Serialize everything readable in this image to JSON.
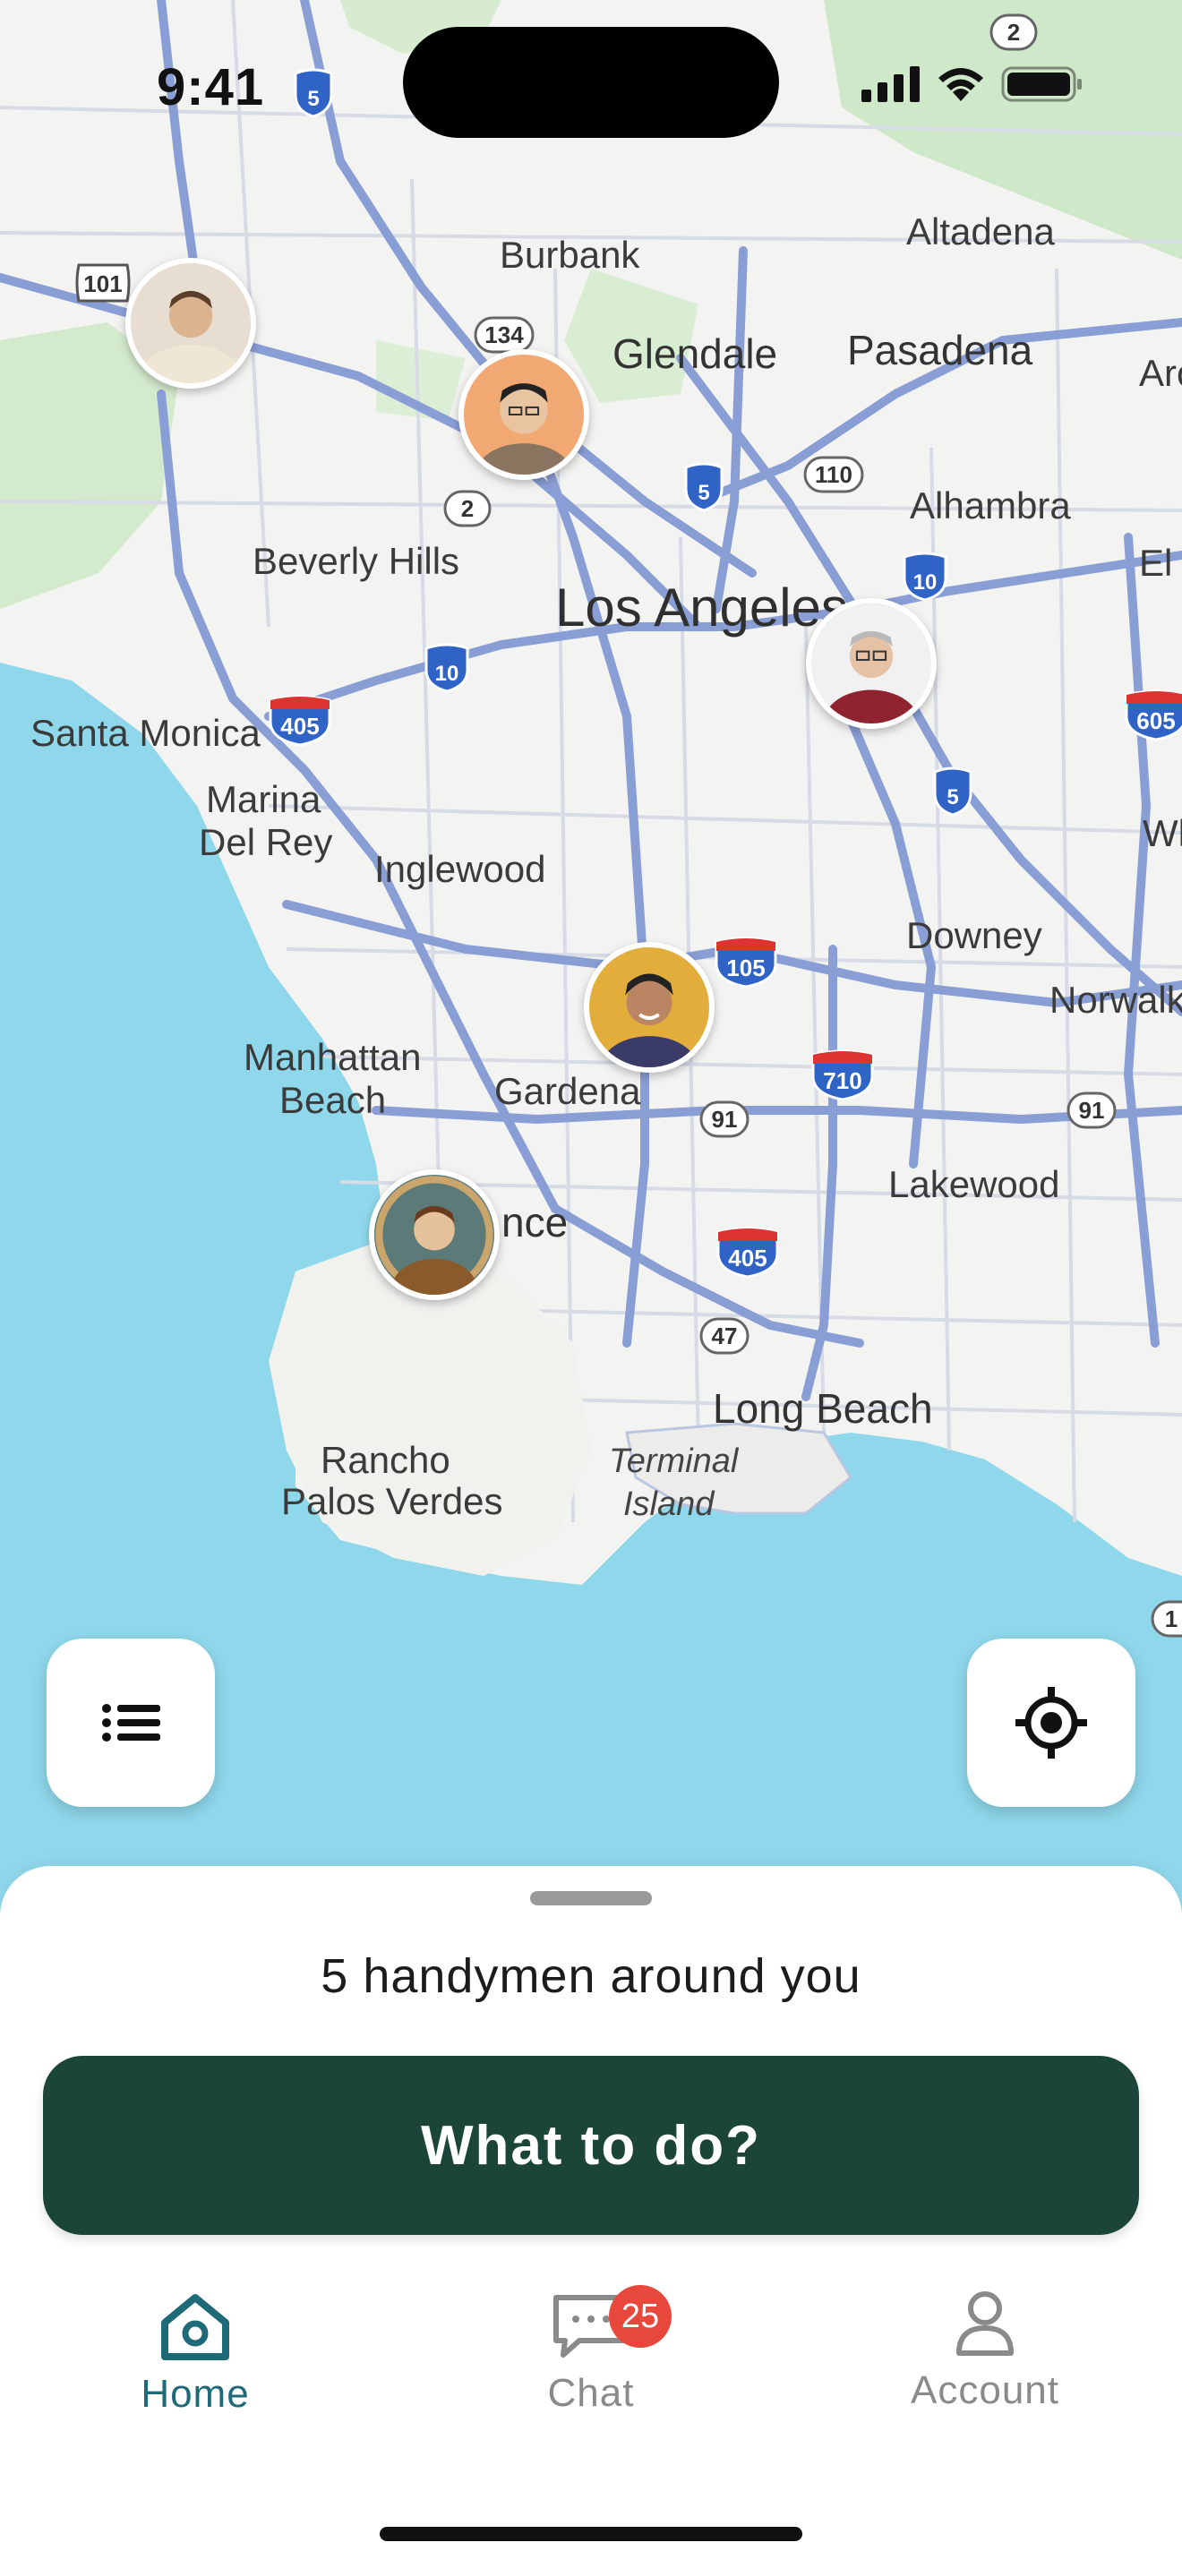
{
  "status_bar": {
    "time": "9:41"
  },
  "map": {
    "places": {
      "burbank": "Burbank",
      "altadena": "Altadena",
      "glendale": "Glendale",
      "pasadena": "Pasadena",
      "arc": "Arc",
      "beverly_hills": "Beverly Hills",
      "alhambra": "Alhambra",
      "el_m": "El M",
      "los_angeles": "Los Angeles",
      "santa_monica": "Santa Monica",
      "marina": "Marina",
      "del_rey": "Del Rey",
      "wh": "Wh",
      "inglewood": "Inglewood",
      "downey": "Downey",
      "norwalk": "Norwalk",
      "manhattan": "Manhattan",
      "beach": "Beach",
      "gardena": "Gardena",
      "lakewood": "Lakewood",
      "torrance_partial": "nce",
      "long_beach": "Long Beach",
      "rancho": "Rancho",
      "palos_verdes": "Palos Verdes",
      "terminal": "Terminal",
      "island": "Island"
    },
    "routes": {
      "i5_top": "5",
      "us101": "101",
      "r134": "134",
      "r2_top": "2",
      "r2": "2",
      "i5_mid": "5",
      "r110": "110",
      "i10_east": "10",
      "i10_west": "10",
      "i405_top": "405",
      "i605": "605",
      "i5_se": "5",
      "i105": "105",
      "i710": "710",
      "r91_mid": "91",
      "r91_east": "91",
      "i405_bottom": "405",
      "r47": "47",
      "r1_edge": "1"
    }
  },
  "pins": [
    {
      "name": "handyman-1"
    },
    {
      "name": "handyman-2"
    },
    {
      "name": "handyman-3"
    },
    {
      "name": "handyman-4"
    },
    {
      "name": "handyman-5"
    }
  ],
  "sheet": {
    "title": "5 handymen around you",
    "cta_label": "What to do?"
  },
  "tabs": {
    "home": "Home",
    "chat": "Chat",
    "chat_badge": "25",
    "account": "Account"
  },
  "colors": {
    "cta": "#1b4538",
    "active_tab": "#1e6a78",
    "badge": "#e8473c",
    "water": "#8fd8ec",
    "road": "#8a9ed6"
  }
}
